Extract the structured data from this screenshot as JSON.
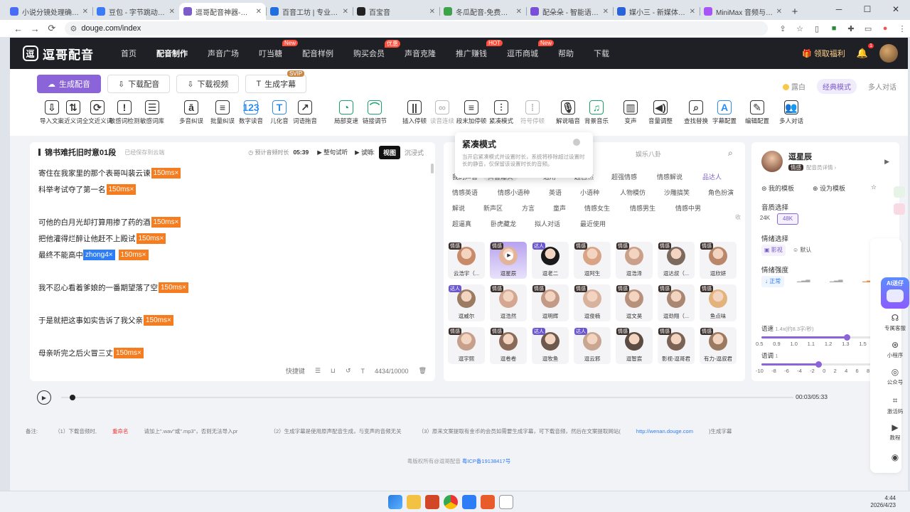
{
  "browser": {
    "tabs": [
      {
        "title": "小说分镜处理确认 - De",
        "color": "#4a6cf7"
      },
      {
        "title": "豆包 - 字节跳动旗下 AI",
        "color": "#3b7cf6"
      },
      {
        "title": "逗哥配音神器-解说逼",
        "color": "#7b5cc9",
        "active": true
      },
      {
        "title": "百音工坊 | 专业智能配",
        "color": "#1f6fe0"
      },
      {
        "title": "百宝音",
        "color": "#222"
      },
      {
        "title": "冬瓜配音-免费文字转语",
        "color": "#3da24a"
      },
      {
        "title": "配朵朵 - 智能语音合成",
        "color": "#7a4fd8"
      },
      {
        "title": "媒小三 - 新媒体工具网",
        "color": "#2a62d8"
      },
      {
        "title": "MiniMax 音频与音乐",
        "color": "#a855f7"
      }
    ],
    "url": "douge.com/index",
    "window_controls": [
      "─",
      "☐",
      "✕"
    ],
    "new_tab": "+"
  },
  "nav": {
    "logo": "逗哥配音",
    "items": [
      {
        "label": "首页"
      },
      {
        "label": "配音制作",
        "current": true
      },
      {
        "label": "声音广场"
      },
      {
        "label": "叮当糖",
        "badge": "New"
      },
      {
        "label": "配音样例"
      },
      {
        "label": "购买会员",
        "badge": "优惠"
      },
      {
        "label": "声音克隆"
      },
      {
        "label": "推广赚钱",
        "badge": "HOT"
      },
      {
        "label": "逗币商城",
        "badge": "New"
      },
      {
        "label": "帮助"
      },
      {
        "label": "下载"
      }
    ],
    "welfare": "领取福利",
    "bell_count": "1"
  },
  "actions": {
    "generate": "生成配音",
    "download_audio": "下载配音",
    "download_video": "下载视频",
    "subtitle": "生成字幕",
    "svip": "SVIP"
  },
  "modes": {
    "theme": "露白",
    "classic": "经典模式",
    "multi": "多人对话"
  },
  "tools": [
    {
      "label": "导入文案",
      "icon": "⇩"
    },
    {
      "label": "近义词",
      "icon": "⇅"
    },
    {
      "label": "全文近义词",
      "icon": "⟳"
    },
    {
      "label": "敏感词检测",
      "icon": "!"
    },
    {
      "label": "敏感词库",
      "icon": "☰"
    },
    {
      "label": "多音纠误",
      "icon": "ā"
    },
    {
      "label": "批量纠误",
      "icon": "≡"
    },
    {
      "label": "数字读音",
      "icon": "123"
    },
    {
      "label": "儿化音",
      "icon": "T"
    },
    {
      "label": "词语拖音",
      "icon": "↗"
    },
    {
      "label": "局部变速",
      "icon": "◔"
    },
    {
      "label": "链接调节",
      "icon": "⌒"
    },
    {
      "label": "插入停顿",
      "icon": "||"
    },
    {
      "label": "读音连续",
      "icon": "∞"
    },
    {
      "label": "段末加停顿",
      "icon": "≡"
    },
    {
      "label": "紧凑模式",
      "icon": "⫶"
    },
    {
      "label": "符号停顿",
      "icon": "⁞"
    },
    {
      "label": "解说喵音",
      "icon": "🎙"
    },
    {
      "label": "背景音乐",
      "icon": "♫"
    },
    {
      "label": "变声",
      "icon": "▥"
    },
    {
      "label": "音量调整",
      "icon": "◀)"
    },
    {
      "label": "查找替换",
      "icon": "⌕"
    },
    {
      "label": "字幕配置",
      "icon": "A"
    },
    {
      "label": "编辑配置",
      "icon": "✎"
    },
    {
      "label": "多人对话",
      "icon": "👥"
    }
  ],
  "tooltip": {
    "title": "紧凑模式",
    "desc": "当开启紧凑模式并设置时长，系统将移除超过设置时长的静音，仅保留该设置时长的音频。"
  },
  "editor": {
    "title": "锦书难托旧时意01段",
    "saved": "已经保存到云端",
    "est_label": "预计音频时长",
    "duration": "05:39",
    "preview_para": "整句试听",
    "preview": "试听",
    "view_tabs": [
      "文本",
      "视图",
      "沉浸式"
    ],
    "view_active": 1,
    "lines": [
      {
        "text": "寄住在我家里的那个表哥叫裴云谏",
        "pause": "150ms×"
      },
      {
        "text": "科举考试夺了第一名",
        "pause": "150ms×"
      },
      {
        "text": "可他的白月光却打算用掺了药的酒",
        "pause": "150ms×"
      },
      {
        "text": "把他灌得烂醉让他赶不上殿试",
        "pause": "150ms×"
      },
      {
        "text": "最终不能高中",
        "pinyin": "zhong4×",
        "pause": "150ms×"
      },
      {
        "text": "我不忍心看着爹娘的一番期望落了空",
        "pause": "150ms×"
      },
      {
        "text": "于是就把这事如实告诉了我父亲",
        "pause": "150ms×"
      },
      {
        "text": "母亲听完之后火冒三丈",
        "pause": "150ms×"
      }
    ],
    "shortcut": "快捷键",
    "count": "4434/10000"
  },
  "voices": {
    "search_placeholder": "娱乐八卦",
    "categories": [
      "我的声音",
      "抖音爆火",
      "通用",
      "超自然",
      "超强情感",
      "情感解说",
      "品达人",
      "情感英语",
      "情感小语种",
      "英语",
      "小语种",
      "人物模仿",
      "沙雕搞笑",
      "角色扮演",
      "解说",
      "新声区",
      "方言",
      "童声",
      "情感女生",
      "情感男生",
      "情感中男",
      "超逼真",
      "卧虎藏龙",
      "拟人对话",
      "最近使用"
    ],
    "collapse": "收",
    "cards": [
      {
        "name": "云浩宇（...",
        "tag": "情感",
        "color": "#c98a6a"
      },
      {
        "name": "逗星辰",
        "tag": "情感",
        "color": "#e4b49a",
        "selected": true
      },
      {
        "name": "逗老二",
        "tag": "达人",
        "color": "#1a1a1a",
        "talent": true
      },
      {
        "name": "逗阿生",
        "tag": "情感",
        "color": "#d9a385"
      },
      {
        "name": "逗浩泽",
        "tag": "情感",
        "color": "#caa08a"
      },
      {
        "name": "逗达叔（...",
        "tag": "情感",
        "color": "#7d6a5e"
      },
      {
        "name": "逗欣妍",
        "tag": "情感",
        "color": "#b9876a"
      },
      {
        "name": "逗威尔",
        "tag": "达人",
        "color": "#9c7b63",
        "talent": true
      },
      {
        "name": "逗浩然",
        "tag": "情感",
        "color": "#d3a792"
      },
      {
        "name": "逗明辉",
        "tag": "情感",
        "color": "#c39a86"
      },
      {
        "name": "逗俊楠",
        "tag": "情感",
        "color": "#d8b29c"
      },
      {
        "name": "逗文昊",
        "tag": "情感",
        "color": "#b8917d"
      },
      {
        "name": "逗劲翔（...",
        "tag": "情感",
        "color": "#a98772"
      },
      {
        "name": "鱼点味",
        "tag": "情感",
        "color": "#e2b47c"
      },
      {
        "name": "逗宇熙",
        "tag": "情感",
        "color": "#c7a08c"
      },
      {
        "name": "逗卷卷",
        "tag": "情感",
        "color": "#8a6a58"
      },
      {
        "name": "逗牧鱼",
        "tag": "达人",
        "color": "#6e5a4c",
        "talent": true
      },
      {
        "name": "逗云邪",
        "tag": "达人",
        "color": "#c9a692",
        "talent": true
      },
      {
        "name": "逗智宸",
        "tag": "情感",
        "color": "#5b4b42"
      },
      {
        "name": "影视-逗哥君",
        "tag": "情感",
        "color": "#7a6354"
      },
      {
        "name": "有力-逗叔君",
        "tag": "情感",
        "color": "#9c7a62"
      }
    ]
  },
  "detail": {
    "name": "逗星辰",
    "tag": "情感",
    "link": "配音员详情 ›",
    "my_template": "我的模板",
    "set_template": "设为模板",
    "quality_label": "音质选择",
    "quality": [
      "24K",
      "48K"
    ],
    "quality_active": 1,
    "emotion_label": "情绪选择",
    "emotions": [
      "影视",
      "默认"
    ],
    "intensity_label": "情绪强度",
    "intensity": "正常",
    "speed_label": "语速",
    "speed_value": "1.4x(约8.3字/秒)",
    "speed_fraction": 0.75,
    "speed_ticks": [
      "0.5",
      "0.9",
      "1.0",
      "1.1",
      "1.2",
      "1.3",
      "1.5",
      "1.7"
    ],
    "pitch_label": "语调",
    "pitch_value": "1",
    "pitch_fraction": 0.5,
    "pitch_ticks": [
      "-10",
      "-8",
      "-6",
      "-4",
      "-2",
      "0",
      "2",
      "4",
      "6",
      "8",
      "10"
    ]
  },
  "player": {
    "time": "00:03/05:33",
    "progress_fraction": 0.01
  },
  "notes": {
    "label": "备注:",
    "n1a": "（1）下载音频时,",
    "n1b": "重命名",
    "n1c": "请加上\".wav\"或\".mp3\"，否则无法导入pr",
    "n2": "（2）生成字幕是使用原声配音生成，与变声的音频无关",
    "n3a": "（3）原来文案提取有金币的会员如需要生成字幕，可下载音频，然后在文案提取网站(",
    "n3b": "http://wenan.douge.com",
    "n3c": ")生成字幕"
  },
  "copyright": {
    "text": "粤版权所有@逗哥配音",
    "icp": "粤ICP备19138417号"
  },
  "float": {
    "ai": "AI送仔",
    "items": [
      {
        "label": "专属客服",
        "icon": "☊"
      },
      {
        "label": "小程序",
        "icon": "⊛"
      },
      {
        "label": "公众号",
        "icon": "◎"
      },
      {
        "label": "激活码",
        "icon": "⌗"
      },
      {
        "label": "教程",
        "icon": "▶"
      },
      {
        "label": "",
        "icon": "◉"
      }
    ]
  },
  "taskbar": {
    "time": "4:44",
    "date": "2026/4/23"
  }
}
